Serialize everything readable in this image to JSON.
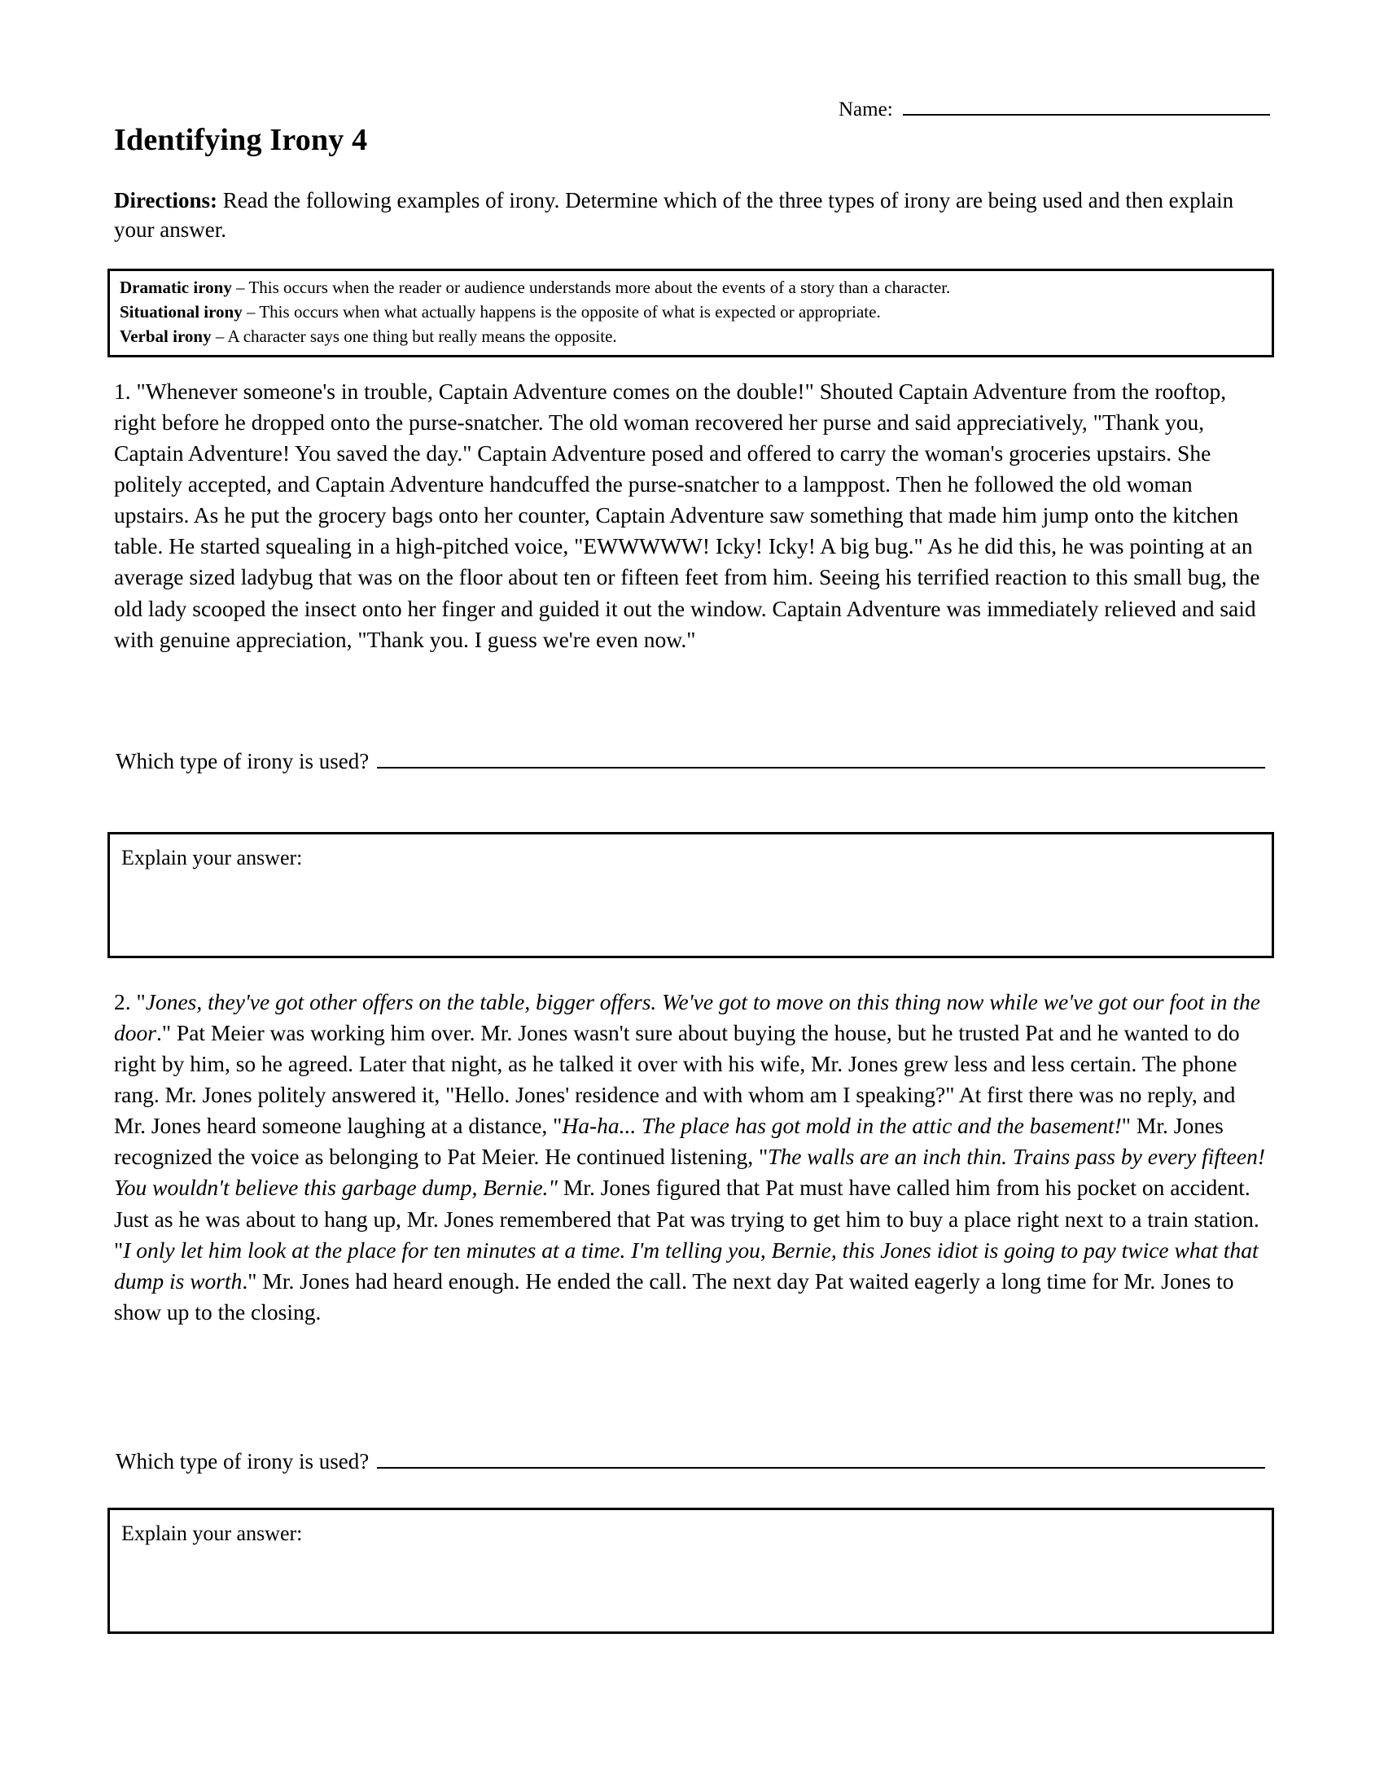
{
  "header": {
    "name_label": "Name:",
    "title": "Identifying Irony 4"
  },
  "directions": {
    "label": "Directions:",
    "text": " Read the following examples of irony. Determine which of the three types of irony are being used and then explain your answer."
  },
  "definitions": [
    {
      "term": "Dramatic irony",
      "dash": " – ",
      "text": "This occurs when the reader or audience understands more about the events of a story than a character."
    },
    {
      "term": "Situational irony",
      "dash": " – ",
      "text": "This occurs when what actually happens is the opposite of what is expected or appropriate."
    },
    {
      "term": "Verbal irony",
      "dash": " – ",
      "text": "A character says one thing but really means the opposite."
    }
  ],
  "questions": [
    {
      "number": "1.",
      "passage_plain": " \"Whenever someone's in trouble, Captain Adventure comes on the double!\" Shouted Captain Adventure from the rooftop, right before he dropped onto the purse-snatcher. The old woman recovered her purse and said appreciatively, \"Thank you, Captain Adventure! You saved the day.\" Captain Adventure posed and offered to carry the woman's groceries upstairs. She politely accepted, and Captain Adventure handcuffed the purse-snatcher to a lamppost. Then he followed the old woman upstairs. As he put the grocery bags onto her counter, Captain Adventure saw something that made him jump onto the kitchen table. He started squealing in a high-pitched voice, \"EWWWWW! Icky! Icky! A big bug.\" As he did this, he was pointing at an average sized ladybug that was on the floor about ten or fifteen feet from him. Seeing his terrified reaction to this small bug, the old lady scooped the insect onto her finger and guided it out the window. Captain Adventure was immediately relieved and said with genuine appreciation, \"Thank you. I guess we're even now.\"",
      "prompt": "Which type of irony is used?",
      "explain_label": "Explain your answer:"
    },
    {
      "number": "2.",
      "segments": [
        {
          "style": "normal",
          "text": " \""
        },
        {
          "style": "italic",
          "text": "Jones, they've got other offers on the table, bigger offers. We've got to move on this thing now while we've got our foot in the door"
        },
        {
          "style": "normal",
          "text": ".\" Pat Meier was working him over. Mr. Jones wasn't sure about buying the house, but he trusted Pat and he wanted to do right by him, so he agreed. Later that night, as he talked it over with his wife, Mr. Jones grew less and less certain. The phone rang. Mr. Jones politely answered it, \"Hello. Jones' residence and with whom am I speaking?\" At first there was no reply, and Mr. Jones heard someone laughing at a distance, \""
        },
        {
          "style": "italic",
          "text": "Ha-ha... The place has got mold in the attic and the basement!"
        },
        {
          "style": "normal",
          "text": "\" Mr. Jones recognized the voice as belonging to Pat Meier. He continued listening, \""
        },
        {
          "style": "italic",
          "text": "The walls are an inch thin. Trains pass by every fifteen! You wouldn't believe this garbage dump, Bernie.\""
        },
        {
          "style": "normal",
          "text": " Mr. Jones figured that Pat must have called him from his pocket on accident. Just as he was about to hang up, Mr. Jones remembered that Pat was trying to get him to buy a place right next to a train station. \""
        },
        {
          "style": "italic",
          "text": "I only let him look at the place for ten minutes at a time. I'm telling you, Bernie, this Jones idiot is going to pay twice what that dump is worth"
        },
        {
          "style": "normal",
          "text": ".\" Mr. Jones had heard enough. He ended the call. The next day Pat waited eagerly a long time for Mr. Jones to show up to the closing."
        }
      ],
      "prompt": "Which type of irony is used?",
      "explain_label": "Explain your answer:"
    }
  ]
}
